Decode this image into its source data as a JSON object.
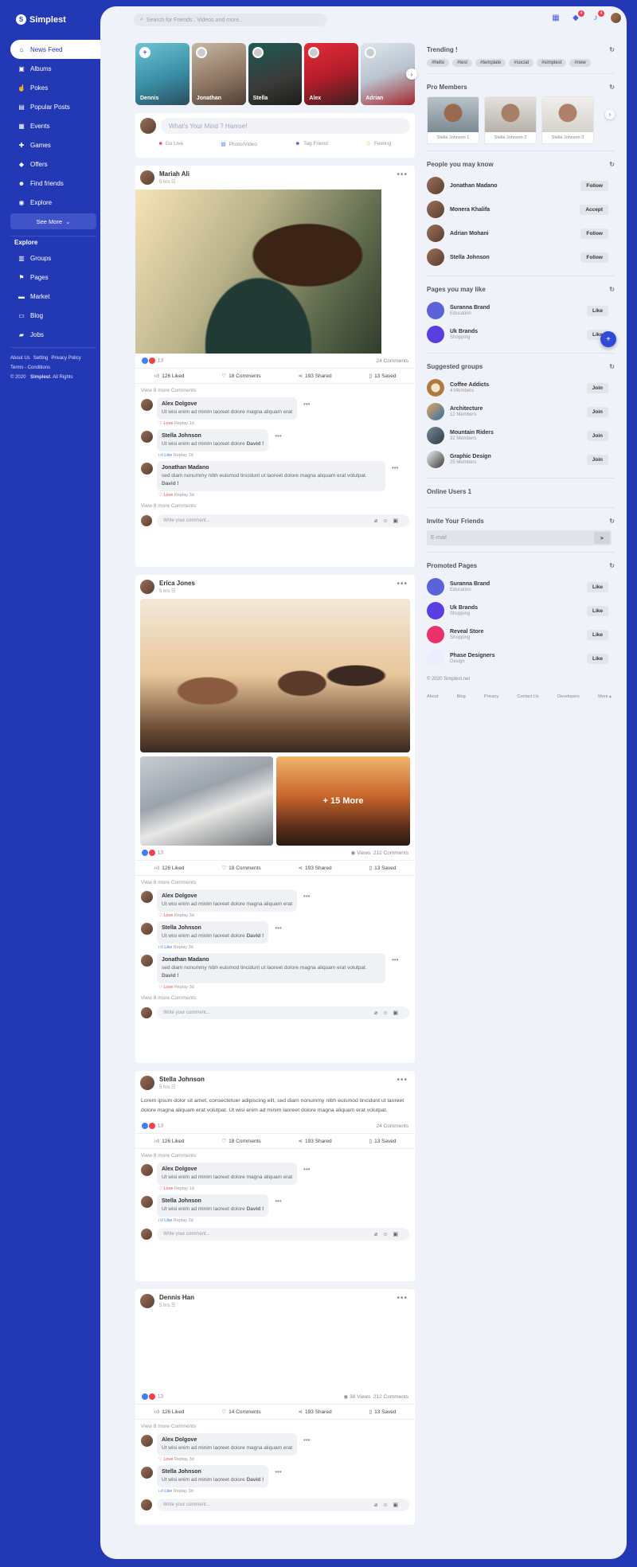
{
  "app": {
    "name": "Simplest"
  },
  "sidebar": {
    "items": [
      {
        "label": "News Feed",
        "icon": "home-icon"
      },
      {
        "label": "Albums",
        "icon": "albums-icon"
      },
      {
        "label": "Pokes",
        "icon": "pokes-icon"
      },
      {
        "label": "Popular Posts",
        "icon": "posts-icon"
      },
      {
        "label": "Events",
        "icon": "calendar-icon"
      },
      {
        "label": "Games",
        "icon": "games-icon"
      },
      {
        "label": "Offers",
        "icon": "tag-icon"
      },
      {
        "label": "Find friends",
        "icon": "users-icon"
      },
      {
        "label": "Explore",
        "icon": "compass-icon"
      }
    ],
    "see_more": "See More",
    "explore_heading": "Explore",
    "explore_items": [
      {
        "label": "Groups"
      },
      {
        "label": "Pages"
      },
      {
        "label": "Market"
      },
      {
        "label": "Blog"
      },
      {
        "label": "Jobs"
      }
    ],
    "footer_links": [
      "About Us",
      "Setting",
      "Privacy Policy",
      "Terms - Conditions"
    ],
    "copyright_prefix": "© 2020",
    "copyright_brand": "Simplest",
    "copyright_suffix": ". All Rights"
  },
  "topbar": {
    "search_placeholder": "Search for Friends , Videos and more..",
    "badges": {
      "messages": "4",
      "notifications": "4"
    }
  },
  "stories": [
    {
      "name": "Dennis"
    },
    {
      "name": "Jonathan"
    },
    {
      "name": "Stella"
    },
    {
      "name": "Alex"
    },
    {
      "name": "Adrian"
    }
  ],
  "composer": {
    "placeholder": "What's Your Mind ? Hamse!",
    "actions": [
      "Go Live",
      "Photo/Video",
      "Tag Friend",
      "Feeling"
    ]
  },
  "posts": [
    {
      "author": "Mariah Ali",
      "time": "5 hrs",
      "react_count": "13",
      "right_stat": "24 Comments",
      "actions": {
        "liked": "126 Liked",
        "comments": "18 Comments",
        "shared": "193 Shared",
        "saved": "13 Saved"
      },
      "view_more_top": "View 8 more Comments",
      "comments": [
        {
          "name": "Alex Dolgove",
          "text": "Ut wisi enim ad minim laoreet dolore magna aliquam erat",
          "react": "Love",
          "reply": "Replay",
          "time": "1d"
        },
        {
          "name": "Stella Johnson",
          "text": "Ut wisi enim ad minim laoreet dolore",
          "bold": "David !",
          "react": "Like",
          "reply": "Replay",
          "time": "2d"
        },
        {
          "name": "Jonathan Madano",
          "text": "sed diam nonummy nibh euismod tincidunt ut laoreet dolore magna aliquam erat volutpat.",
          "bold": "David !",
          "react": "Love",
          "reply": "Replay",
          "time": "3d"
        }
      ],
      "view_more_bottom": "View 8 more Comments",
      "write_placeholder": "Write your comment..."
    },
    {
      "author": "Erica Jones",
      "time": "5 hrs",
      "react_count": "13",
      "views": "Views",
      "right_stat": "212 Comments",
      "more_overlay": "+ 15 More",
      "actions": {
        "liked": "126 Liked",
        "comments": "18 Comments",
        "shared": "193 Shared",
        "saved": "13 Saved"
      },
      "view_more_top": "View 8 more Comments",
      "comments": [
        {
          "name": "Alex Dolgove",
          "text": "Ut wisi enim ad minim laoreet dolore magna aliquam erat",
          "react": "Love",
          "reply": "Replay",
          "time": "3d"
        },
        {
          "name": "Stella Johnson",
          "text": "Ut wisi enim ad minim laoreet dolore",
          "bold": "David !",
          "react": "Like",
          "reply": "Replay",
          "time": "3d"
        },
        {
          "name": "Jonathan Madano",
          "text": "sed diam nonummy nibh euismod tincidunt ut laoreet dolore magna aliquam erat volutpat.",
          "bold": "David !",
          "react": "Love",
          "reply": "Replay",
          "time": "3d"
        }
      ],
      "view_more_bottom": "View 8 more Comments",
      "write_placeholder": "Write your comment..."
    },
    {
      "author": "Stella Johnson",
      "time": "5 hrs",
      "text": "Lorem ipsum dolor sit amet, consectetuer adipiscing elit, sed diam nonummy nibh euismod tincidunt ut laoreet dolore magna aliquam erat volutpat. Ut wisi enim ad minim laoreet dolore magna aliquam erat volutpat.",
      "react_count": "13",
      "right_stat": "24 Comments",
      "actions": {
        "liked": "126 Liked",
        "comments": "18 Comments",
        "shared": "193 Shared",
        "saved": "13 Saved"
      },
      "view_more_top": "View 8 more Comments",
      "comments": [
        {
          "name": "Alex Dolgove",
          "text": "Ut wisi enim ad minim laoreet dolore magna aliquam erat",
          "react": "Love",
          "reply": "Replay",
          "time": "1d"
        },
        {
          "name": "Stella Johnson",
          "text": "Ut wisi enim ad minim laoreet dolore",
          "bold": "David !",
          "react": "Like",
          "reply": "Replay",
          "time": "2d"
        }
      ],
      "write_placeholder": "Write your comment..."
    },
    {
      "author": "Dennis Han",
      "time": "5 hrs",
      "react_count": "13",
      "views": "38 Views",
      "right_stat": "212 Comments",
      "actions": {
        "liked": "126 Liked",
        "comments": "14 Comments",
        "shared": "193 Shared",
        "saved": "13 Saved"
      },
      "view_more_top": "View 8 more Comments",
      "comments": [
        {
          "name": "Alex Dolgove",
          "text": "Ut wisi enim ad minim laoreet dolore magna aliquam erat",
          "react": "Love",
          "reply": "Replay",
          "time": "3d"
        },
        {
          "name": "Stella Johnson",
          "text": "Ut wisi enim ad minim laoreet dolore",
          "bold": "David !",
          "react": "Like",
          "reply": "Replay",
          "time": "3d"
        }
      ],
      "write_placeholder": "Write your comment..."
    }
  ],
  "right": {
    "trending": {
      "title": "Trending !",
      "tags": [
        "#hello",
        "#test",
        "#template",
        "#social",
        "#simplest",
        "#new"
      ]
    },
    "pro": {
      "title": "Pro Members",
      "members": [
        "Stella Johnson 1",
        "Stella Johnson 2",
        "Stella Johnson 3"
      ]
    },
    "people": {
      "title": "People you may know",
      "items": [
        {
          "name": "Jonathan Madano",
          "btn": "Follow"
        },
        {
          "name": "Monera Khalifa",
          "btn": "Accept"
        },
        {
          "name": "Adrian Mohani",
          "btn": "Follow"
        },
        {
          "name": "Stella Johnson",
          "btn": "Follow"
        }
      ]
    },
    "pages": {
      "title": "Pages you may like",
      "items": [
        {
          "name": "Suranna Brand",
          "sub": "Education",
          "btn": "Like"
        },
        {
          "name": "Uk Brands",
          "sub": "Shopping",
          "btn": "Like"
        }
      ]
    },
    "groups": {
      "title": "Suggested groups",
      "items": [
        {
          "name": "Coffee Addicts",
          "sub": "4 Members",
          "btn": "Join"
        },
        {
          "name": "Architecture",
          "sub": "12 Members",
          "btn": "Join"
        },
        {
          "name": "Mountain Riders",
          "sub": "32 Members",
          "btn": "Join"
        },
        {
          "name": "Graphic Design",
          "sub": "25 Members",
          "btn": "Join"
        }
      ]
    },
    "online": {
      "title": "Online Users 1"
    },
    "invite": {
      "title": "Invite Your Friends",
      "placeholder": "E-mail"
    },
    "promoted": {
      "title": "Promoted Pages",
      "items": [
        {
          "name": "Suranna Brand",
          "sub": "Education",
          "btn": "Like"
        },
        {
          "name": "Uk Brands",
          "sub": "Shopping",
          "btn": "Like"
        },
        {
          "name": "Reveal Store",
          "sub": "Shopping",
          "btn": "Like"
        },
        {
          "name": "Phase Designers",
          "sub": "Design",
          "btn": "Like"
        }
      ]
    },
    "copyright": "© 2020 Simplest.net",
    "footer_links": [
      "About",
      "Blog",
      "Privacy",
      "Contact Us",
      "Developers",
      "More ▴"
    ]
  },
  "colors": {
    "brand": "#2338b5",
    "accent": "#4a5be0",
    "badge": "#f0414f",
    "love": "#f0414f",
    "like": "#3b82f6"
  }
}
